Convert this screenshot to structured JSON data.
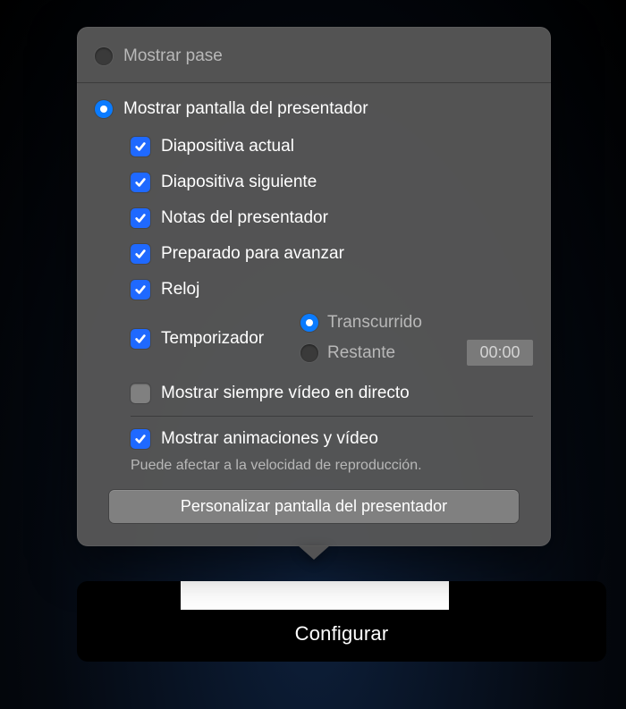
{
  "configure_button": "Configurar",
  "radios": {
    "show_slideshow": "Mostrar pase",
    "show_presenter_display": "Mostrar pantalla del presentador"
  },
  "checks": {
    "current_slide": "Diapositiva actual",
    "next_slide": "Diapositiva siguiente",
    "presenter_notes": "Notas del presentador",
    "ready_to_advance": "Preparado para avanzar",
    "clock": "Reloj",
    "timer": "Temporizador",
    "always_show_live_video": "Mostrar siempre vídeo en directo",
    "show_animations_video": "Mostrar animaciones y vídeo"
  },
  "timer_modes": {
    "elapsed": "Transcurrido",
    "remaining": "Restante"
  },
  "time_value": "00:00",
  "hint_text": "Puede afectar a la velocidad de reproducción.",
  "footer_button": "Personalizar pantalla del presentador",
  "colors": {
    "accent": "#1f69ff",
    "radio_on": "#0a7bff",
    "panel_bg": "#585858"
  }
}
